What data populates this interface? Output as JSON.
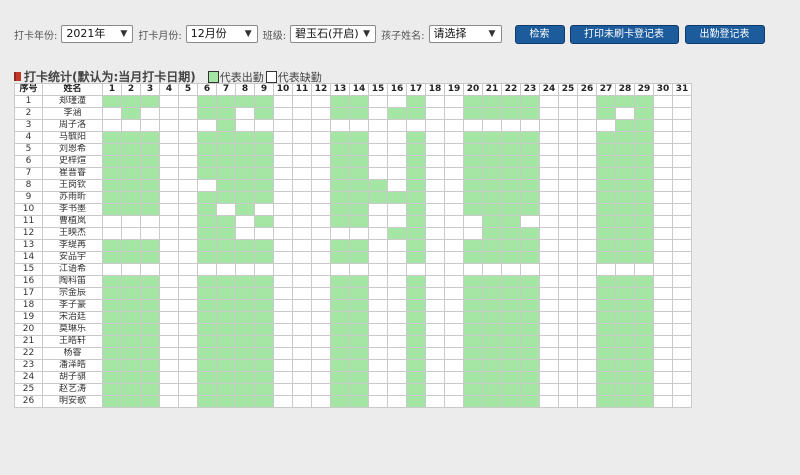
{
  "toolbar": {
    "year_label": "打卡年份:",
    "year_value": "2021年",
    "month_label": "打卡月份:",
    "month_value": "12月份",
    "class_label": "班级:",
    "class_value": "碧玉石(开启)",
    "child_label": "孩子姓名:",
    "child_value": "请选择",
    "search_label": "检索",
    "print_label": "打印未刷卡登记表",
    "attendance_label": "出勤登记表"
  },
  "section": {
    "title": "打卡统计(默认为:当月打卡日期)",
    "legend_present": "代表出勤",
    "legend_absent": "代表缺勤"
  },
  "colors": {
    "present": "#a5e6a5",
    "absent": "#ffffff",
    "button": "#1c5b9c"
  },
  "table": {
    "headers": {
      "seq": "序号",
      "name": "姓名"
    },
    "days": [
      "1",
      "2",
      "3",
      "4",
      "5",
      "6",
      "7",
      "8",
      "9",
      "10",
      "11",
      "12",
      "13",
      "14",
      "15",
      "16",
      "17",
      "18",
      "19",
      "20",
      "21",
      "22",
      "23",
      "24",
      "25",
      "26",
      "27",
      "28",
      "29",
      "30",
      "31"
    ],
    "rows": [
      {
        "seq": "1",
        "name": "郑瑾潼",
        "days": "1110011110001100100111100011100"
      },
      {
        "seq": "2",
        "name": "李涵",
        "days": "0100011010001101100111100010100"
      },
      {
        "seq": "3",
        "name": "周子洛",
        "days": "0000001000000000000000000001100"
      },
      {
        "seq": "4",
        "name": "马毓阳",
        "days": "1110011110001100100111100011100"
      },
      {
        "seq": "5",
        "name": "刘恩希",
        "days": "1110011110001100100111100011100"
      },
      {
        "seq": "6",
        "name": "史梓煊",
        "days": "1110011110001100100111100011100"
      },
      {
        "seq": "7",
        "name": "崔晋睿",
        "days": "1110011110001100100111100011100"
      },
      {
        "seq": "8",
        "name": "王岗钦",
        "days": "1110001110001110100111100011100"
      },
      {
        "seq": "9",
        "name": "苏雨昕",
        "days": "1110011110001111100111100011100"
      },
      {
        "seq": "10",
        "name": "李书墨",
        "days": "1110010100001100100111100011100"
      },
      {
        "seq": "11",
        "name": "曹植岚",
        "days": "0000011010001100100011000011100"
      },
      {
        "seq": "12",
        "name": "王映杰",
        "days": "0000011000000001100011100011100"
      },
      {
        "seq": "13",
        "name": "李缇苒",
        "days": "1110011110001100100111100011100"
      },
      {
        "seq": "14",
        "name": "安品宇",
        "days": "1110011110001100100111100011100"
      },
      {
        "seq": "15",
        "name": "江语希",
        "days": "0000000000000000000000000000000"
      },
      {
        "seq": "16",
        "name": "陶科笛",
        "days": "1110011110001100100111100011100"
      },
      {
        "seq": "17",
        "name": "宗金辰",
        "days": "1110011110001100100111100011100"
      },
      {
        "seq": "18",
        "name": "李子豪",
        "days": "1110011110001100100111100011100"
      },
      {
        "seq": "19",
        "name": "宋治廷",
        "days": "1110011110001100100111100011100"
      },
      {
        "seq": "20",
        "name": "莫琳乐",
        "days": "1110011110001100100111100011100"
      },
      {
        "seq": "21",
        "name": "王皓轩",
        "days": "1110011110001100100111100011100"
      },
      {
        "seq": "22",
        "name": "杨睿",
        "days": "1110011110001100100111100011100"
      },
      {
        "seq": "23",
        "name": "潘泽皓",
        "days": "1110011110001100100111100011100"
      },
      {
        "seq": "24",
        "name": "胡子骐",
        "days": "1110011110001100100111100011100"
      },
      {
        "seq": "25",
        "name": "赵艺涛",
        "days": "1110011110001100100111100011100"
      },
      {
        "seq": "26",
        "name": "明安歌",
        "days": "1110011110001100100111100011100"
      }
    ]
  }
}
